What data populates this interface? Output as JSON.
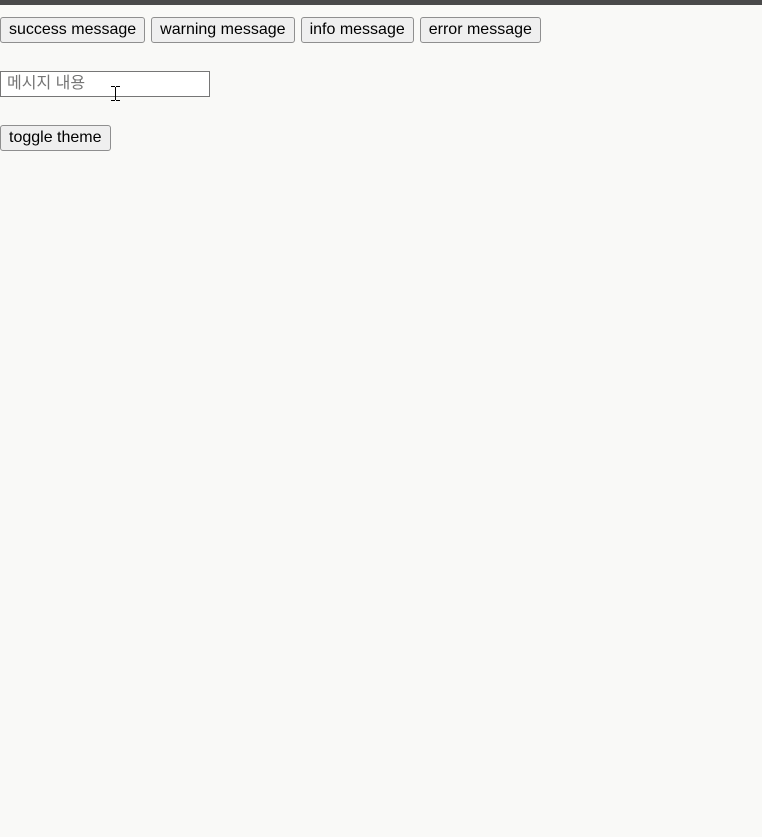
{
  "buttons": {
    "success": "success message",
    "warning": "warning message",
    "info": "info message",
    "error": "error message"
  },
  "input": {
    "placeholder": "메시지 내용",
    "value": ""
  },
  "toggle": {
    "label": "toggle theme"
  }
}
